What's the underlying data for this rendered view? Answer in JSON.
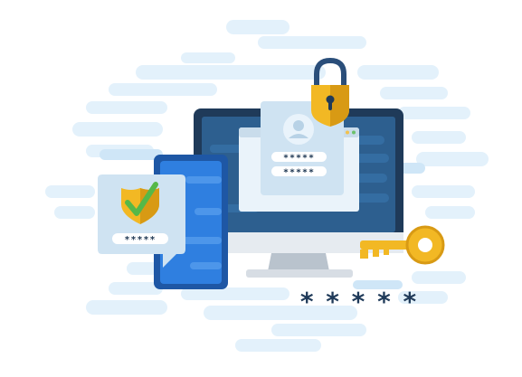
{
  "illustration": {
    "pin_mask_phone_bubble": "*****",
    "pin_mask_dialog_row1": "*****",
    "pin_mask_dialog_row2": "*****",
    "password_mask_bottom": "* * * * *"
  },
  "colors": {
    "cloud_light": "#e3f1fb",
    "cloud_mid": "#cfe6f7",
    "monitor_frame": "#1f3a59",
    "monitor_screen": "#2d5f8f",
    "monitor_stand": "#d7dde4",
    "phone_body": "#1e57a5",
    "phone_screen": "#2f7fe0",
    "panel_fill": "#cfe3f2",
    "panel_dark": "#223a55",
    "gold": "#f2b824",
    "gold_dark": "#d18f10",
    "check_green": "#56b848"
  },
  "icons": {
    "lock": "padlock-icon",
    "shield": "shield-check-icon",
    "key": "key-icon",
    "user": "user-avatar-icon"
  }
}
